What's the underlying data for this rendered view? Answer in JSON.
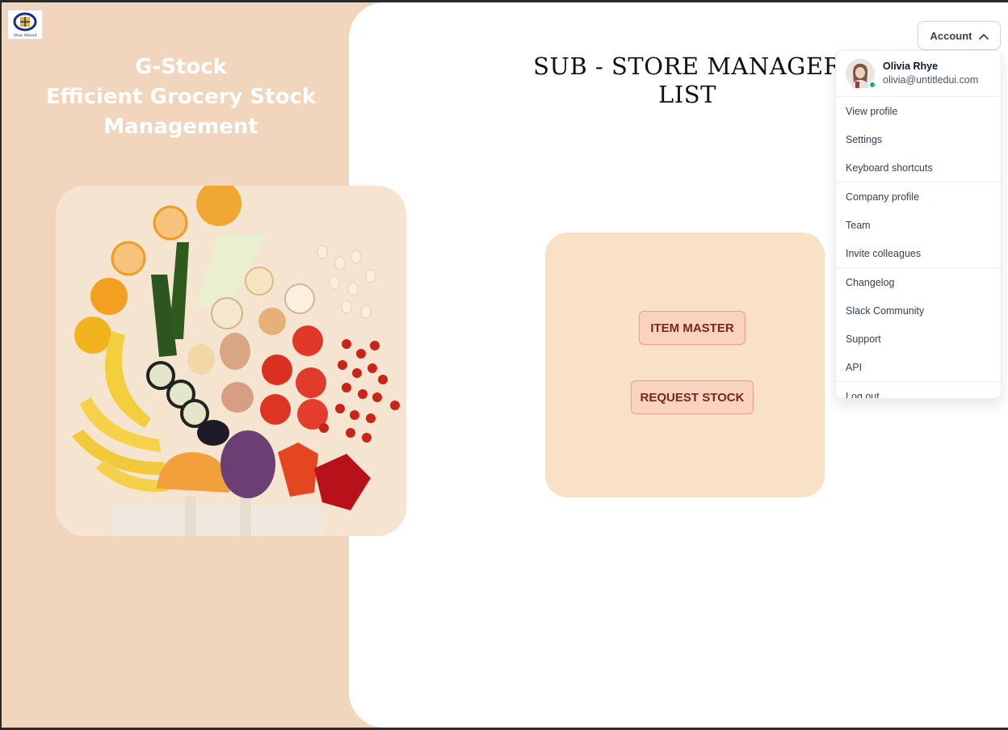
{
  "brand": {
    "logo_tagline": "Stay Ahead",
    "line1": "G-Stock",
    "line2": "Efficient Grocery Stock",
    "line3": "Management"
  },
  "page": {
    "title_line1": "SUB - STORE MANAGER",
    "title_line2": "LIST"
  },
  "actions": {
    "item_master": "ITEM MASTER",
    "request_stock": "REQUEST STOCK"
  },
  "account": {
    "button_label": "Account",
    "user_name": "Olivia Rhye",
    "user_email": "olivia@untitledui.com",
    "status_color": "#12b76a",
    "menu_groups": [
      [
        "View profile",
        "Settings",
        "Keyboard shortcuts"
      ],
      [
        "Company profile",
        "Team",
        "Invite colleagues"
      ],
      [
        "Changelog",
        "Slack Community",
        "Support",
        "API"
      ],
      [
        "Log out"
      ]
    ]
  },
  "colors": {
    "left_panel": "#f1d5bc",
    "card": "#f9e1c6",
    "button_fill": "#f9d3c0",
    "button_text": "#7b2716"
  },
  "icons": {
    "logo": "company-logo-icon",
    "account_chevron": "chevron-up-icon",
    "user_avatar": "avatar-icon",
    "produce_photo": "grocery-produce-image"
  }
}
